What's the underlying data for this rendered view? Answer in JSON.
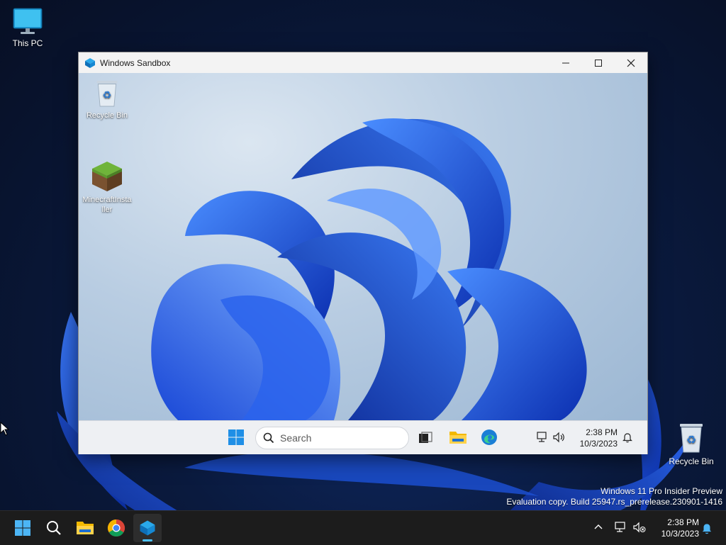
{
  "host": {
    "desktop_icons": [
      {
        "label": "This PC",
        "icon": "monitor-icon"
      },
      {
        "label": "Recycle Bin",
        "icon": "recycle-bin-icon"
      }
    ],
    "watermark": {
      "line1": "Windows 11 Pro Insider Preview",
      "line2": "Evaluation copy. Build 25947.rs_prerelease.230901-1416"
    },
    "taskbar": {
      "items": [
        {
          "name": "start",
          "icon": "windows-logo-icon"
        },
        {
          "name": "search",
          "icon": "search-icon"
        },
        {
          "name": "file-explorer",
          "icon": "folder-icon"
        },
        {
          "name": "chrome",
          "icon": "chrome-icon"
        },
        {
          "name": "windows-sandbox",
          "icon": "sandbox-icon",
          "active": true
        }
      ],
      "time": "2:38 PM",
      "date": "10/3/2023"
    }
  },
  "sandbox_window": {
    "title": "Windows Sandbox",
    "controls": [
      "minimize",
      "maximize",
      "close"
    ],
    "desktop_icons": [
      {
        "label": "Recycle Bin",
        "icon": "recycle-bin-icon"
      },
      {
        "label_line1": "MinecraftInsta",
        "label_line2": "ller",
        "icon": "minecraft-grass-block-icon"
      }
    ],
    "taskbar": {
      "search_placeholder": "Search",
      "time": "2:38 PM",
      "date": "10/3/2023"
    }
  },
  "colors": {
    "accent": "#4cc2ff",
    "bloom_blue": "#1f5fe0",
    "host_taskbar": "#1c1c1c"
  }
}
